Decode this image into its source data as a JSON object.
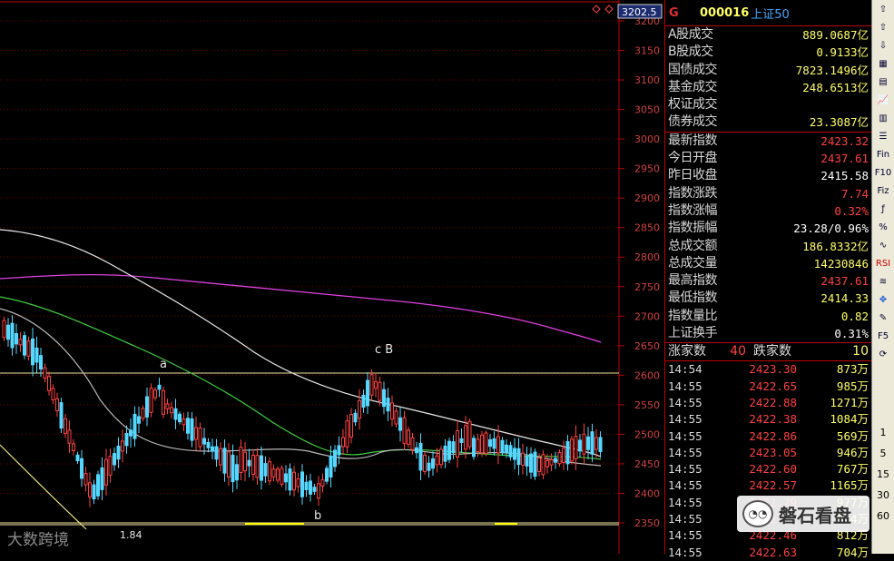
{
  "chart": {
    "top_price_label": "3202.5",
    "y_axis_ticks": [
      "3200",
      "3150",
      "3100",
      "3050",
      "3000",
      "2950",
      "2900",
      "2850",
      "2800",
      "2750",
      "2700",
      "2650",
      "2600",
      "2550",
      "2500",
      "2450",
      "2400",
      "2350"
    ],
    "annotations": {
      "a": "a",
      "b": "b",
      "cB": "c B"
    },
    "low_price_label": "1.84"
  },
  "header": {
    "g": "G",
    "code": "000016",
    "name": "上证50"
  },
  "volume_block": [
    {
      "k": "A股成交",
      "v": "889.0687亿",
      "c": "yellow"
    },
    {
      "k": "B股成交",
      "v": "0.9133亿",
      "c": "yellow"
    },
    {
      "k": "国债成交",
      "v": "7823.1496亿",
      "c": "yellow"
    },
    {
      "k": "基金成交",
      "v": "248.6513亿",
      "c": "yellow"
    },
    {
      "k": "权证成交",
      "v": "",
      "c": "yellow"
    },
    {
      "k": "债券成交",
      "v": "23.3087亿",
      "c": "yellow"
    }
  ],
  "index_block": [
    {
      "k": "最新指数",
      "v": "2423.32",
      "c": "red"
    },
    {
      "k": "今日开盘",
      "v": "2437.61",
      "c": "red"
    },
    {
      "k": "昨日收盘",
      "v": "2415.58",
      "c": "white"
    },
    {
      "k": "指数涨跌",
      "v": "7.74",
      "c": "red"
    },
    {
      "k": "指数涨幅",
      "v": "0.32%",
      "c": "red"
    },
    {
      "k": "指数振幅",
      "v": "23.28/0.96%",
      "c": "white"
    },
    {
      "k": "总成交额",
      "v": "186.8332亿",
      "c": "yellow"
    },
    {
      "k": "总成交量",
      "v": "14230846",
      "c": "yellow"
    },
    {
      "k": "最高指数",
      "v": "2437.61",
      "c": "red"
    },
    {
      "k": "最低指数",
      "v": "2414.33",
      "c": "yellow"
    },
    {
      "k": "指数量比",
      "v": "0.82",
      "c": "yellow"
    },
    {
      "k": "上证换手",
      "v": "0.31%",
      "c": "white"
    }
  ],
  "up_down": {
    "up_label": "涨家数",
    "up": "40",
    "down_label": "跌家数",
    "down": "10"
  },
  "ticks": [
    {
      "t": "14:54",
      "p": "2423.30",
      "v": "873万"
    },
    {
      "t": "14:55",
      "p": "2422.65",
      "v": "985万"
    },
    {
      "t": "14:55",
      "p": "2422.88",
      "v": "1271万"
    },
    {
      "t": "14:55",
      "p": "2422.38",
      "v": "1084万"
    },
    {
      "t": "14:55",
      "p": "2422.86",
      "v": "569万"
    },
    {
      "t": "14:55",
      "p": "2423.05",
      "v": "946万"
    },
    {
      "t": "14:55",
      "p": "2422.60",
      "v": "767万"
    },
    {
      "t": "14:55",
      "p": "2422.57",
      "v": "1165万"
    },
    {
      "t": "14:55",
      "p": "2422.79",
      "v": "977万"
    },
    {
      "t": "14:55",
      "p": "2422.37",
      "v": "954万"
    },
    {
      "t": "14:55",
      "p": "2422.46",
      "v": "812万"
    },
    {
      "t": "14:55",
      "p": "2422.63",
      "v": "704万"
    }
  ],
  "toolbar": {
    "buttons": [
      "up-arrow",
      "up",
      "down",
      "grid",
      "table",
      "chart",
      "candle",
      "list",
      "Fin",
      "F10",
      "Fiz",
      "F",
      "pct",
      "wave",
      "RSI",
      "lines",
      "move",
      "pen",
      "F5",
      "refresh"
    ],
    "numbers": [
      "1",
      "5",
      "15",
      "30",
      "60"
    ]
  },
  "watermarks": {
    "left": "大数跨境",
    "right": "磐石看盘"
  }
}
